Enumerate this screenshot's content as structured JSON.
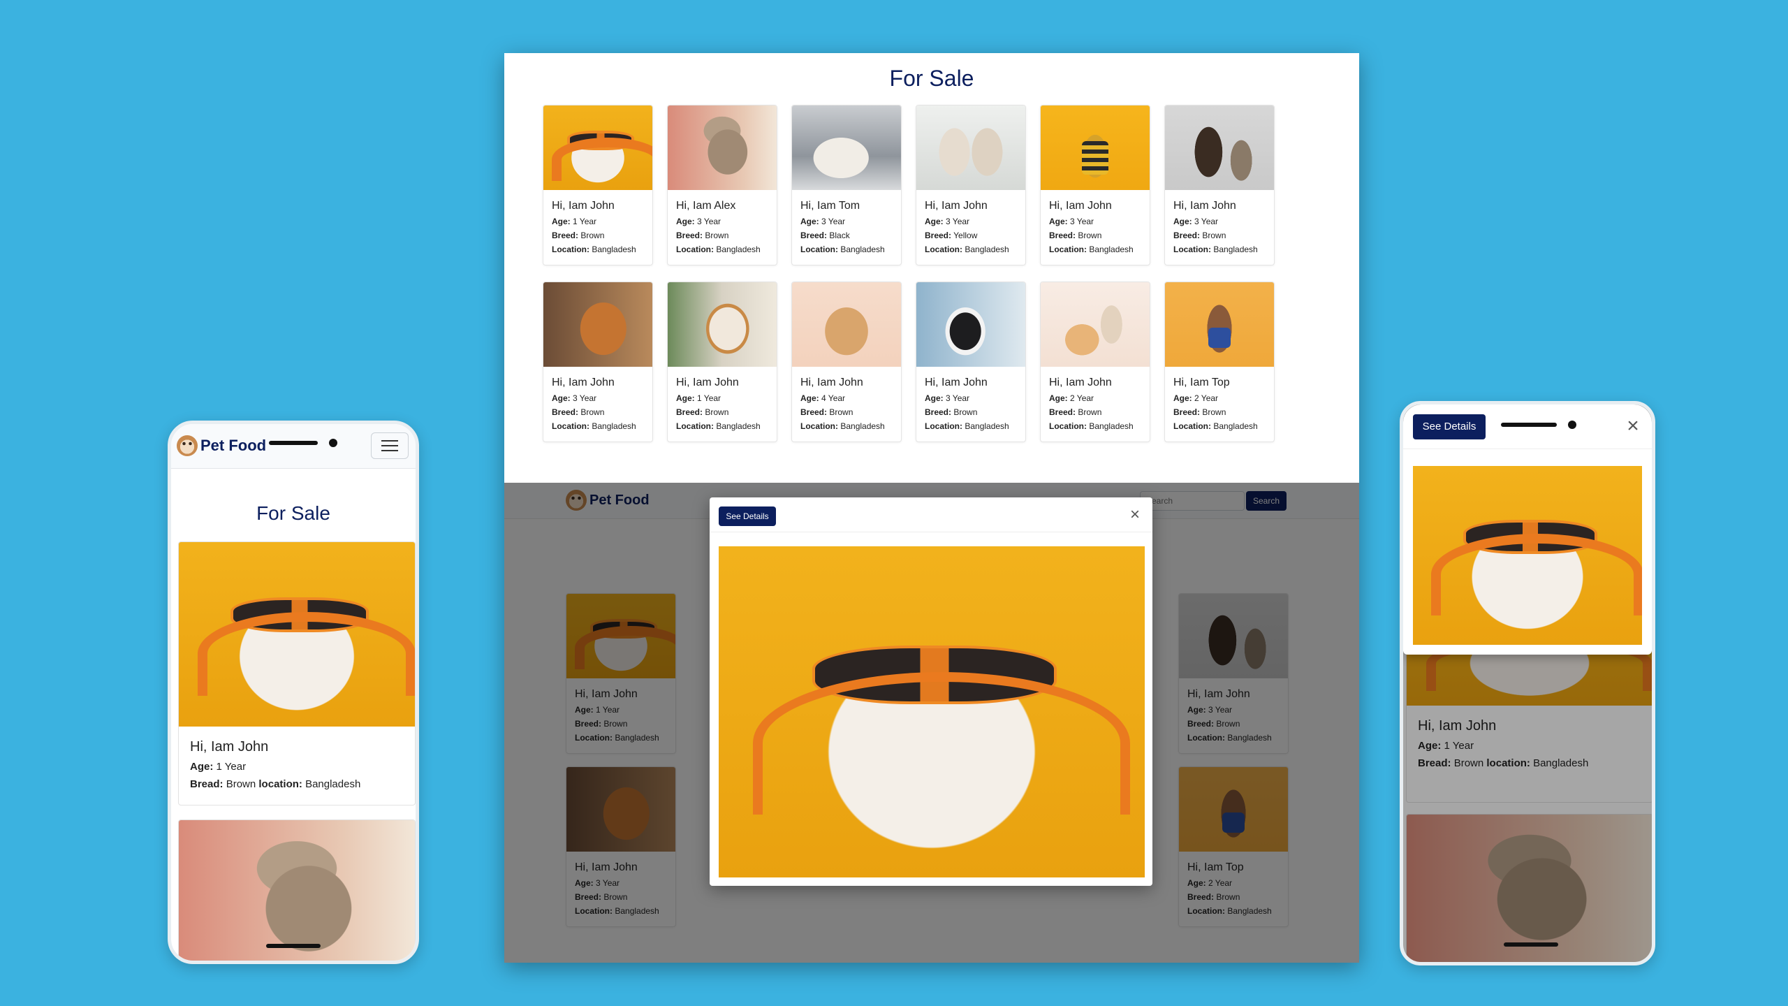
{
  "colors": {
    "background": "#3bb2e0",
    "brand": "#0c1f5e",
    "card_border": "#e4e4e4"
  },
  "desktop": {
    "title": "For Sale",
    "cards": [
      {
        "name": "Hi, Iam John",
        "age": "1 Year",
        "breed": "Brown",
        "location": "Bangladesh",
        "image": "dog-headphones-orange"
      },
      {
        "name": "Hi, Iam Alex",
        "age": "3 Year",
        "breed": "Brown",
        "location": "Bangladesh",
        "image": "cat-pink"
      },
      {
        "name": "Hi, Iam Tom",
        "age": "3 Year",
        "breed": "Black",
        "location": "Bangladesh",
        "image": "cat-white"
      },
      {
        "name": "Hi, Iam John",
        "age": "3 Year",
        "breed": "Yellow",
        "location": "Bangladesh",
        "image": "cats-two"
      },
      {
        "name": "Hi, Iam John",
        "age": "3 Year",
        "breed": "Brown",
        "location": "Bangladesh",
        "image": "dog-yellow"
      },
      {
        "name": "Hi, Iam John",
        "age": "3 Year",
        "breed": "Brown",
        "location": "Bangladesh",
        "image": "dogs-gray"
      },
      {
        "name": "Hi, Iam John",
        "age": "3 Year",
        "breed": "Brown",
        "location": "Bangladesh",
        "image": "cat-orange"
      },
      {
        "name": "Hi, Iam John",
        "age": "1 Year",
        "breed": "Brown",
        "location": "Bangladesh",
        "image": "cat-window"
      },
      {
        "name": "Hi, Iam John",
        "age": "4 Year",
        "breed": "Brown",
        "location": "Bangladesh",
        "image": "dog-peach"
      },
      {
        "name": "Hi, Iam John",
        "age": "3 Year",
        "breed": "Brown",
        "location": "Bangladesh",
        "image": "dog-bw"
      },
      {
        "name": "Hi, Iam John",
        "age": "2 Year",
        "breed": "Brown",
        "location": "Bangladesh",
        "image": "pets-cream"
      },
      {
        "name": "Hi, Iam Top",
        "age": "2 Year",
        "breed": "Brown",
        "location": "Bangladesh",
        "image": "dog-amber"
      }
    ],
    "labels": {
      "age": "Age:",
      "breed": "Breed:",
      "location": "Location:"
    },
    "navbar": {
      "brand": "Pet Food",
      "search_placeholder": "Search",
      "search_button": "Search"
    },
    "modal": {
      "button": "See Details",
      "close": "×"
    }
  },
  "dimmed_cards": [
    {
      "name": "Hi, Iam John",
      "age": "1 Year",
      "breed": "Brown",
      "location": "Bangladesh"
    },
    {
      "name": "Hi, Iam John",
      "age": "3 Year",
      "breed": "Brown",
      "location": "Bangladesh"
    },
    {
      "name": "Hi, Iam John",
      "age": "3 Year",
      "breed": "Brown",
      "location": "Bangladesh"
    },
    {
      "name": "Hi, Iam Top",
      "age": "2 Year",
      "breed": "Brown",
      "location": "Bangladesh"
    }
  ],
  "phone_left": {
    "brand": "Pet Food",
    "menu_icon": "hamburger-icon",
    "title": "For Sale",
    "card": {
      "name": "Hi, Iam John",
      "age_label": "Age:",
      "age": "1 Year",
      "bread_label": "Bread:",
      "bread": "Brown",
      "location_label": "location:",
      "location": "Bangladesh"
    }
  },
  "phone_right": {
    "button": "See Details",
    "close": "×",
    "card": {
      "name": "Hi, Iam John",
      "age_label": "Age:",
      "age": "1 Year",
      "bread_label": "Bread:",
      "bread": "Brown",
      "location_label": "location:",
      "location": "Bangladesh"
    }
  }
}
